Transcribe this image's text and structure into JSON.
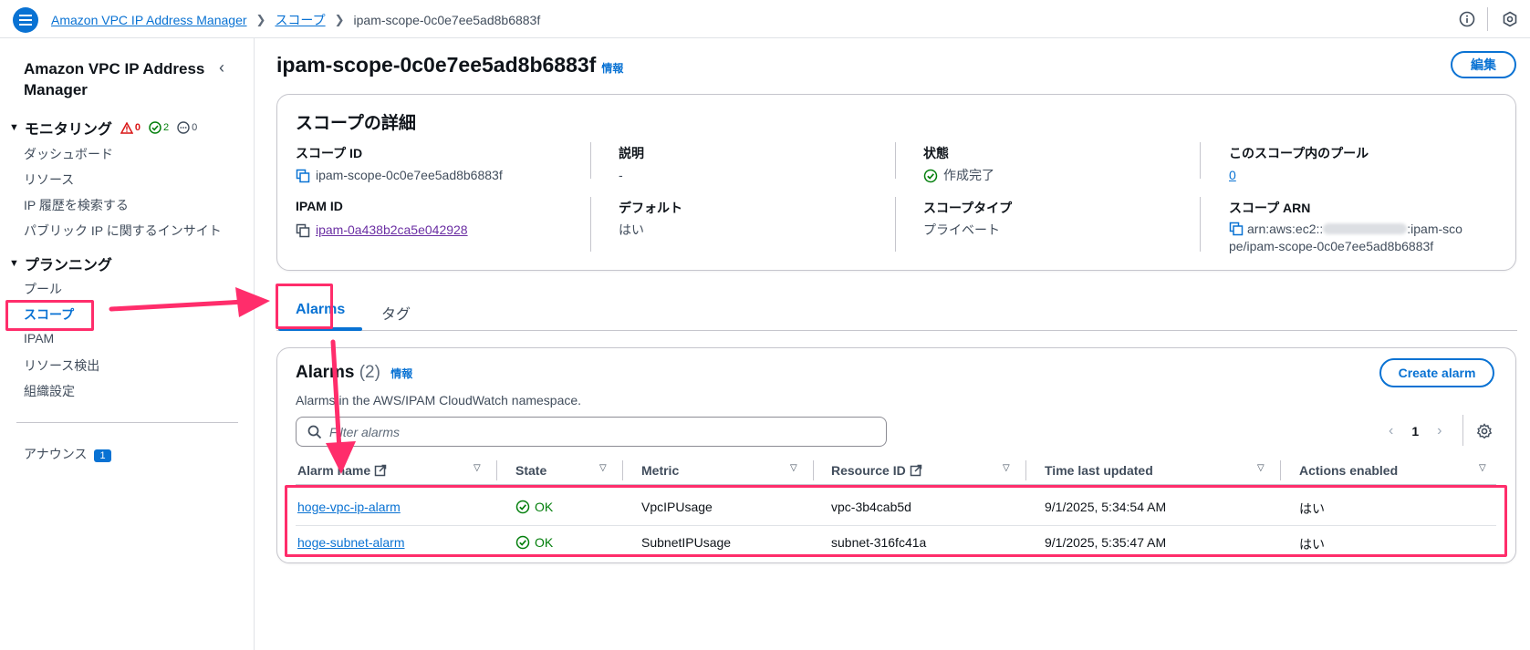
{
  "breadcrumb": [
    "Amazon VPC IP Address Manager",
    "スコープ",
    "ipam-scope-0c0e7ee5ad8b6883f"
  ],
  "sidebar": {
    "title": "Amazon VPC IP Address Manager",
    "monitoring": {
      "label": "モニタリング",
      "warn_count": "0",
      "ok_count": "2",
      "pending_count": "0"
    },
    "monitoring_items": [
      "ダッシュボード",
      "リソース",
      "IP 履歴を検索する",
      "パブリック IP に関するインサイト"
    ],
    "planning": {
      "label": "プランニング"
    },
    "planning_items": [
      "プール",
      "スコープ",
      "IPAM",
      "リソース検出",
      "組織設定"
    ],
    "announce": {
      "label": "アナウンス",
      "badge": "1"
    }
  },
  "page": {
    "title": "ipam-scope-0c0e7ee5ad8b6883f",
    "info": "情報",
    "edit": "編集"
  },
  "details": {
    "title": "スコープの詳細",
    "scope_id": {
      "label": "スコープ ID",
      "value": "ipam-scope-0c0e7ee5ad8b6883f"
    },
    "description": {
      "label": "説明",
      "value": "-"
    },
    "state": {
      "label": "状態",
      "value": "作成完了"
    },
    "pools": {
      "label": "このスコープ内のプール",
      "value": "0"
    },
    "ipam_id": {
      "label": "IPAM ID",
      "value": "ipam-0a438b2ca5e042928"
    },
    "default": {
      "label": "デフォルト",
      "value": "はい"
    },
    "scope_type": {
      "label": "スコープタイプ",
      "value": "プライベート"
    },
    "arn": {
      "label": "スコープ ARN",
      "line1_prefix": "arn:aws:ec2::",
      "line1_suffix": ":ipam-sco",
      "line2": "pe/ipam-scope-0c0e7ee5ad8b6883f"
    }
  },
  "tabs": [
    "Alarms",
    "タグ"
  ],
  "alarms": {
    "title": "Alarms",
    "count": "(2)",
    "info": "情報",
    "subtitle": "Alarms in the AWS/IPAM CloudWatch namespace.",
    "create": "Create alarm",
    "search_placeholder": "Filter alarms",
    "page": "1",
    "columns": [
      "Alarm name",
      "State",
      "Metric",
      "Resource ID",
      "Time last updated",
      "Actions enabled"
    ],
    "rows": [
      {
        "name": "hoge-vpc-ip-alarm",
        "state": "OK",
        "metric": "VpcIPUsage",
        "resource": "vpc-3b4cab5d",
        "updated": "9/1/2025, 5:34:54 AM",
        "actions": "はい"
      },
      {
        "name": "hoge-subnet-alarm",
        "state": "OK",
        "metric": "SubnetIPUsage",
        "resource": "subnet-316fc41a",
        "updated": "9/1/2025, 5:35:47 AM",
        "actions": "はい"
      }
    ]
  },
  "colors": {
    "accent": "#0972d3",
    "success": "#037f0c",
    "annotation": "#ff2d6b"
  }
}
